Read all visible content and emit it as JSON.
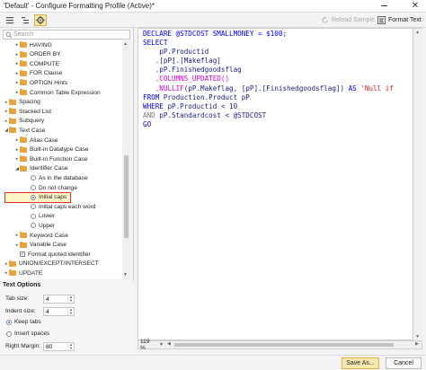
{
  "window": {
    "title": "'Default' - Configure Formatting Profile (Active)*",
    "close_glyph": "✕"
  },
  "toolbar": {
    "reload_sample": "Reload Sample",
    "format_text": "Format Text"
  },
  "search": {
    "placeholder": "Search"
  },
  "tree": [
    {
      "label": "HAVING",
      "type": "folder",
      "arrow": "▸"
    },
    {
      "label": "ORDER BY",
      "type": "folder",
      "arrow": "▸"
    },
    {
      "label": "COMPUTE",
      "type": "folder",
      "arrow": "▸"
    },
    {
      "label": "FOR Clause",
      "type": "folder",
      "arrow": "▸"
    },
    {
      "label": "OPTION Hints",
      "type": "folder",
      "arrow": "▸"
    },
    {
      "label": "Common Table Expression",
      "type": "folder",
      "arrow": "▸"
    },
    {
      "label": "Spacing",
      "type": "folder",
      "arrow": "▸"
    },
    {
      "label": "Stacked List",
      "type": "folder",
      "arrow": "▸"
    },
    {
      "label": "Subquery",
      "type": "folder",
      "arrow": "▸"
    },
    {
      "label": "Text Case",
      "type": "folder",
      "arrow": "◢"
    },
    {
      "label": "Alias Case",
      "type": "folder",
      "arrow": "▸"
    },
    {
      "label": "Built-in Datatype Case",
      "type": "folder",
      "arrow": "▸"
    },
    {
      "label": "Built-in Function Case",
      "type": "folder",
      "arrow": "▸"
    },
    {
      "label": "Identifier Case",
      "type": "folder",
      "arrow": "◢"
    },
    {
      "label": "As in the database",
      "type": "radio",
      "selected": false
    },
    {
      "label": "Do not change",
      "type": "radio",
      "selected": false
    },
    {
      "label": "Initial caps",
      "type": "radio",
      "selected": true
    },
    {
      "label": "Initial caps each word",
      "type": "radio",
      "selected": false
    },
    {
      "label": "Lower",
      "type": "radio",
      "selected": false
    },
    {
      "label": "Upper",
      "type": "radio",
      "selected": false
    },
    {
      "label": "Keyword Case",
      "type": "folder",
      "arrow": "▸"
    },
    {
      "label": "Variable Case",
      "type": "folder",
      "arrow": "▸"
    },
    {
      "label": "Format quoted identifier",
      "type": "check",
      "checked": true
    },
    {
      "label": "UNION/EXCEPT/INTERSECT",
      "type": "folder",
      "arrow": "▸"
    },
    {
      "label": "UPDATE",
      "type": "folder",
      "arrow": "▸"
    }
  ],
  "text_options": {
    "title": "Text Options",
    "tab_size_label": "Tab size:",
    "tab_size_value": "4",
    "indent_size_label": "Indent size:",
    "indent_size_value": "4",
    "keep_tabs_label": "Keep tabs",
    "insert_spaces_label": "Insert spaces",
    "right_margin_label": "Right Margin:",
    "right_margin_value": "80"
  },
  "editor": {
    "lines": [
      [
        {
          "t": "DECLARE @STDCOST SMALLMONEY = $100;",
          "c": "kw"
        }
      ],
      [
        {
          "t": "SELECT",
          "c": "kw"
        }
      ],
      [
        {
          "t": "    pP.Productid",
          "c": "id"
        }
      ],
      [
        {
          "t": "   ,",
          "c": "gray"
        },
        {
          "t": "[pP].[Makeflag]",
          "c": "id"
        }
      ],
      [
        {
          "t": "   ,",
          "c": "gray"
        },
        {
          "t": "pP.Finishedgoodsflag",
          "c": "id"
        }
      ],
      [
        {
          "t": "   ,",
          "c": "gray"
        },
        {
          "t": "COLUMNS_UPDATED()",
          "c": "fn"
        }
      ],
      [
        {
          "t": "   ,",
          "c": "gray"
        },
        {
          "t": "NULLIF",
          "c": "fn"
        },
        {
          "t": "(pP.Makeflag, [pP].[Finishedgoodsflag]) ",
          "c": "id"
        },
        {
          "t": "AS ",
          "c": "kw"
        },
        {
          "t": "'Null if",
          "c": "str"
        }
      ],
      [
        {
          "t": "FROM ",
          "c": "kw"
        },
        {
          "t": "Production.Product pP",
          "c": "id"
        }
      ],
      [
        {
          "t": "WHERE ",
          "c": "kw"
        },
        {
          "t": "pP.Productid < 10",
          "c": "id"
        }
      ],
      [
        {
          "t": "AND ",
          "c": "gray"
        },
        {
          "t": "pP.Standardcost < @STDCOST",
          "c": "id"
        }
      ],
      [
        {
          "t": "GO",
          "c": "kw"
        }
      ]
    ]
  },
  "status": {
    "zoom": "119 %"
  },
  "buttons": {
    "save_as": "Save As...",
    "cancel": "Cancel"
  }
}
